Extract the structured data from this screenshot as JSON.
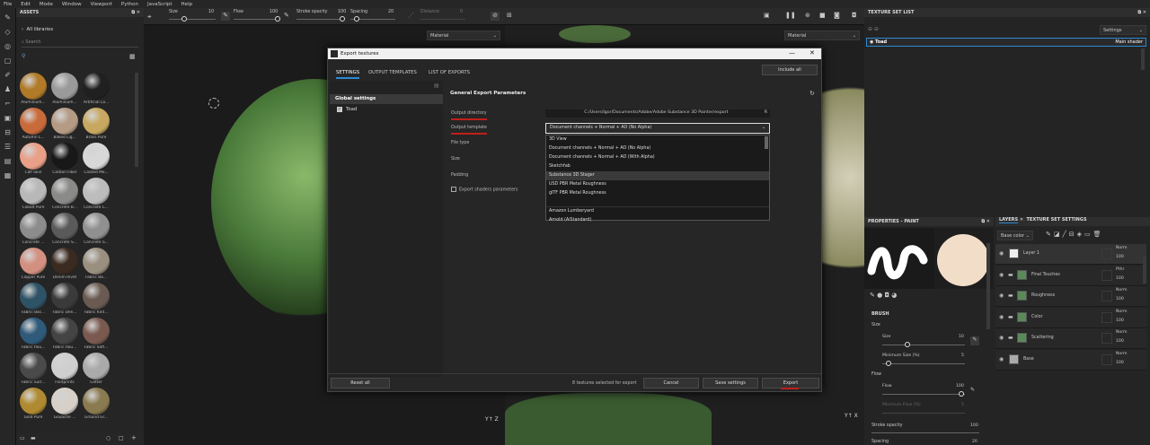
{
  "menu": [
    "File",
    "Edit",
    "Mode",
    "Window",
    "Viewport",
    "Python",
    "JavaScript",
    "Help"
  ],
  "toolbar": {
    "size_label": "Size",
    "size_val": "10",
    "flow_label": "Flow",
    "flow_val": "100",
    "stroke_label": "Stroke opacity",
    "stroke_val": "100",
    "spacing_label": "Spacing",
    "spacing_val": "20",
    "distance_label": "Distance",
    "distance_val": "0"
  },
  "assets": {
    "title": "ASSETS",
    "libraries": "All libraries",
    "search": "Search",
    "items": [
      "Aluminium...",
      "Aluminium...",
      "Artificial La...",
      "Autumn L...",
      "Baked Lig...",
      "Brass Pure",
      "Calf Skin",
      "Carbon Fiber",
      "Coated Me...",
      "Cobalt Pure",
      "Concrete B...",
      "Concrete C...",
      "Concrete ...",
      "Concrete S...",
      "Concrete S...",
      "Copper Pure",
      "Denim Rivet",
      "Fabric Ba...",
      "Fabric Bas...",
      "Fabric Den...",
      "Fabric Knit...",
      "Fabric Rou...",
      "Fabric Rou...",
      "Fabric Soft...",
      "Fabric Suit...",
      "Footprints",
      "Glitter",
      "Gold Pure",
      "Gouache ...",
      "Ground Gr..."
    ],
    "colors": [
      "#b07a28",
      "#9a9a9a",
      "#202020",
      "#c96a3a",
      "#b59a84",
      "#c8a860",
      "#e8a088",
      "#181818",
      "#d8d8d8",
      "#b8b8b8",
      "#8a8a88",
      "#bcbcbc",
      "#8c8c8c",
      "#5a5a5a",
      "#909090",
      "#d39080",
      "#3a2a20",
      "#9a9080",
      "#2e5266",
      "#3a3a3a",
      "#6a5a52",
      "#2f5a7a",
      "#444444",
      "#7a5a50",
      "#4a4a4a",
      "#cfcfcf",
      "#aaaaaa",
      "#b08a30",
      "#d7d0c8",
      "#8a7a50"
    ]
  },
  "viewport": {
    "material_left": "Material",
    "material_right": "Material"
  },
  "dialog": {
    "title": "Export textures",
    "tabs": [
      "SETTINGS",
      "OUTPUT TEMPLATES",
      "LIST OF EXPORTS"
    ],
    "include_all": "Include all",
    "global_settings": "Global settings",
    "toad": "Toad",
    "section": "General Export Parameters",
    "output_dir_label": "Output directory",
    "output_dir_value": "C:/Users/Igor/Documents/Adobe/Adobe Substance 3D Painter/export",
    "output_template_label": "Output template",
    "output_template_value": "Document channels + Normal + AO (No Alpha)",
    "file_type": "File type",
    "size": "Size",
    "padding": "Padding",
    "export_shaders": "Export shaders parameters",
    "templates": [
      "3D View",
      "Document channels + Normal + AO (No Alpha)",
      "Document channels + Normal + AO (With Alpha)",
      "Sketchfab",
      "Substance 3D Stager",
      "USD PBR Metal Roughness",
      "glTF PBR Metal Roughness",
      "",
      "Amazon Lumberyard",
      "Arnold (AiStandard)"
    ],
    "reset_all": "Reset all",
    "status": "8 textures selected for export",
    "cancel": "Cancel",
    "save_settings": "Save settings",
    "export": "Export"
  },
  "texture_set_list": {
    "title": "TEXTURE SET LIST",
    "settings": "Settings",
    "toad": "Toad",
    "shader": "Main shader"
  },
  "properties": {
    "title": "PROPERTIES - PAINT",
    "brush": "BRUSH",
    "size": "Size",
    "size_sub": "Size",
    "size_val": "10",
    "min_size": "Minimum Size (%)",
    "min_size_val": "5",
    "flow": "Flow",
    "flow_sub": "Flow",
    "flow_val": "100",
    "min_flow": "Minimum Flow (%)",
    "min_flow_val": "5",
    "stroke_opacity": "Stroke opacity",
    "stroke_val": "100",
    "spacing": "Spacing",
    "spacing_val": "20"
  },
  "layers": {
    "tab1": "LAYERS",
    "tab2": "TEXTURE SET SETTINGS",
    "channel": "Base color",
    "items": [
      {
        "name": "Layer 1",
        "blend": "Norm",
        "val": "100"
      },
      {
        "name": "Final Touches",
        "blend": "Pthr",
        "val": "100"
      },
      {
        "name": "Roughness",
        "blend": "Norm",
        "val": "100"
      },
      {
        "name": "Color",
        "blend": "Norm",
        "val": "100"
      },
      {
        "name": "Scattering",
        "blend": "Norm",
        "val": "100"
      },
      {
        "name": "Base",
        "blend": "Norm",
        "val": "100"
      }
    ]
  }
}
